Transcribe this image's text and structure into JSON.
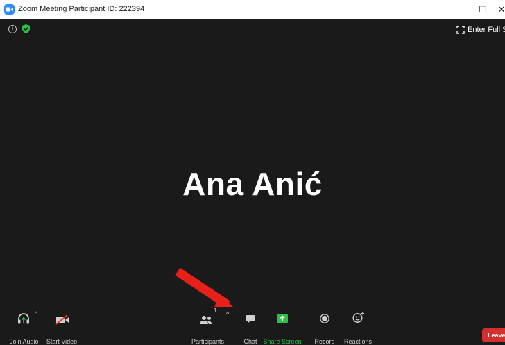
{
  "window": {
    "title": "Zoom Meeting Participant ID: 222394",
    "minimize_glyph": "–",
    "maximize_glyph": "☐",
    "close_glyph": "✕"
  },
  "stage": {
    "participant_name": "Ana Anić",
    "fullscreen_label": "Enter Full Screen"
  },
  "toolbar": {
    "join_audio": "Join Audio",
    "start_video": "Start Video",
    "participants": "Participants",
    "participants_count": "1",
    "chat": "Chat",
    "share_screen": "Share Screen",
    "record": "Record",
    "reactions": "Reactions",
    "leave": "Leave"
  },
  "icons": {
    "logo": "zoom-logo-icon",
    "info": "info-icon",
    "shield": "shield-icon",
    "fullscreen": "fullscreen-icon",
    "audio": "headphones-icon",
    "video": "video-off-icon",
    "participants": "people-icon",
    "chat": "chat-icon",
    "share": "share-screen-icon",
    "record": "record-icon",
    "reactions": "smiley-icon",
    "annotation": "red-arrow"
  },
  "colors": {
    "background": "#1a1a1a",
    "zoom_blue": "#2d8cff",
    "share_green": "#27c346",
    "leave_red": "#d32f2f",
    "arrow_red": "#e8201a"
  }
}
